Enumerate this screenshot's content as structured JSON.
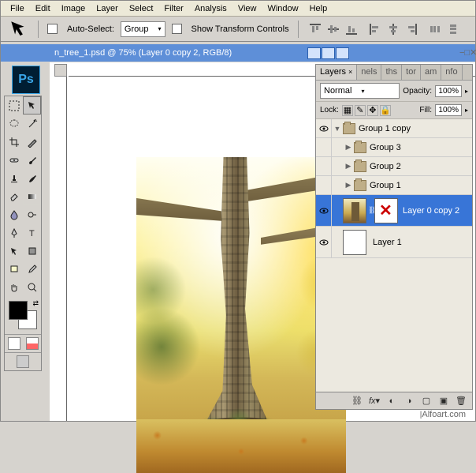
{
  "menu": [
    "File",
    "Edit",
    "Image",
    "Layer",
    "Select",
    "Filter",
    "Analysis",
    "View",
    "Window",
    "Help"
  ],
  "optionsBar": {
    "autoSelect": "Auto-Select:",
    "autoSelectValue": "Group",
    "showTransform": "Show Transform Controls"
  },
  "document": {
    "title": "n_tree_1.psd @ 75% (Layer 0 copy 2, RGB/8)"
  },
  "layersPanel": {
    "tabs": [
      "Layers",
      "nels",
      "ths",
      "tor",
      "am",
      "nfo"
    ],
    "activeTab": 0,
    "blendMode": "Normal",
    "opacityLabel": "Opacity:",
    "opacityValue": "100%",
    "lockLabel": "Lock:",
    "fillLabel": "Fill:",
    "fillValue": "100%",
    "layers": [
      {
        "type": "group",
        "name": "Group 1 copy",
        "expanded": true,
        "eye": true,
        "depth": 0
      },
      {
        "type": "group",
        "name": "Group 3",
        "expanded": false,
        "eye": false,
        "depth": 1
      },
      {
        "type": "group",
        "name": "Group 2",
        "expanded": false,
        "eye": false,
        "depth": 1
      },
      {
        "type": "group",
        "name": "Group 1",
        "expanded": false,
        "eye": false,
        "depth": 1
      },
      {
        "type": "layer",
        "name": "Layer 0 copy 2",
        "eye": true,
        "depth": 1,
        "selected": true,
        "hasMask": true
      },
      {
        "type": "layer",
        "name": "Layer 1",
        "eye": true,
        "depth": 0,
        "thumb": "white"
      }
    ]
  },
  "watermark": "Alfoart.com"
}
